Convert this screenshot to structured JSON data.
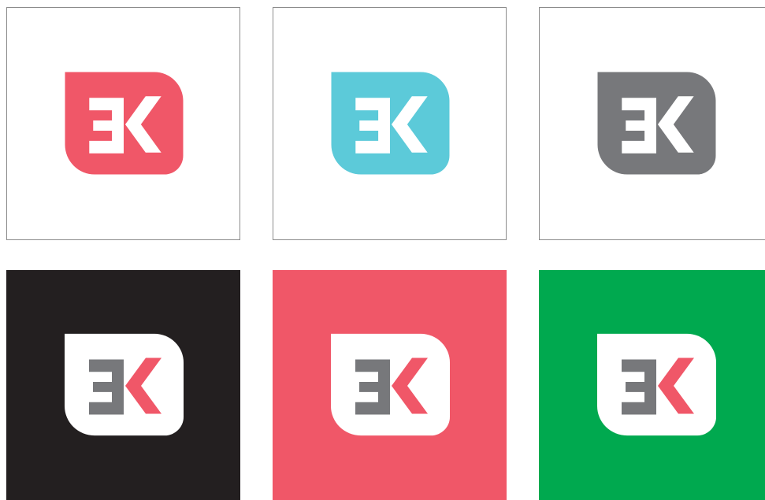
{
  "logo_variants": [
    {
      "id": "tile-1",
      "background": "#ffffff",
      "outlined": true,
      "badge": "#f05768",
      "left_mark": "#ffffff",
      "right_mark": "#ffffff"
    },
    {
      "id": "tile-2",
      "background": "#ffffff",
      "outlined": true,
      "badge": "#5ccad9",
      "left_mark": "#ffffff",
      "right_mark": "#ffffff"
    },
    {
      "id": "tile-3",
      "background": "#ffffff",
      "outlined": true,
      "badge": "#77787b",
      "left_mark": "#ffffff",
      "right_mark": "#ffffff"
    },
    {
      "id": "tile-4",
      "background": "#231f20",
      "outlined": false,
      "badge": "#ffffff",
      "left_mark": "#77787b",
      "right_mark": "#f05768"
    },
    {
      "id": "tile-5",
      "background": "#f05768",
      "outlined": false,
      "badge": "#ffffff",
      "left_mark": "#77787b",
      "right_mark": "#f05768"
    },
    {
      "id": "tile-6",
      "background": "#00a94f",
      "outlined": false,
      "badge": "#ffffff",
      "left_mark": "#77787b",
      "right_mark": "#f05768"
    }
  ],
  "icons": {
    "badge": "dk-monogram-badge-icon"
  }
}
